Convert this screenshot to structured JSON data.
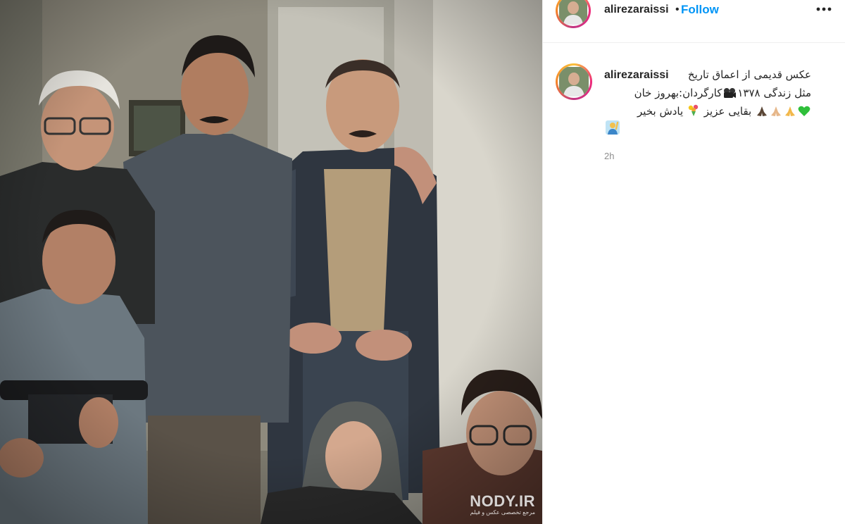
{
  "post": {
    "username": "alirezaraissi",
    "separator": "•",
    "follow_label": "Follow",
    "timestamp": "2h"
  },
  "caption": {
    "username": "alirezaraissi",
    "line1": "عکس قدیمی از اعماق تاریخ",
    "line2_text": "مثل زندگی ۱۳۷۸",
    "line2_after": "کارگردان:بهروز خان",
    "line3_words": "بقایی عزیز",
    "line3_after": "یادش بخیر"
  },
  "icons": {
    "more": "more-options-icon",
    "film": "film-camera-icon",
    "heart": "green-heart-icon",
    "pray": "folded-hands-icon",
    "bouquet": "bouquet-icon",
    "raise": "person-raising-hand-icon"
  },
  "colors": {
    "follow": "#0095f6",
    "muted": "#8e8e8e",
    "text": "#262626"
  },
  "watermark": {
    "main": "NODY.IR",
    "sub": "مرجع تخصصی عکس و فیلم"
  }
}
